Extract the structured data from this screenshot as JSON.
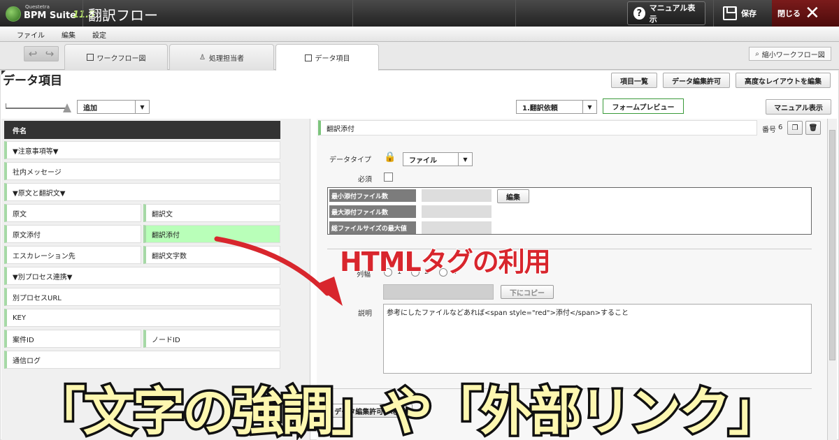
{
  "app": {
    "logo_small": "Questetra",
    "logo_name": "BPM Suite",
    "logo_version": "11.5",
    "title": "翻訳フロー",
    "manual_button": "マニュアル表示",
    "save_button": "保存",
    "close_button": "閉じる"
  },
  "menu": {
    "file": "ファイル",
    "edit": "編集",
    "settings": "設定"
  },
  "tabs": {
    "workflow": "ワークフロー図",
    "assignee": "処理担当者",
    "data_items": "データ項目",
    "mini_workflow": "縮小ワークフロー図"
  },
  "header": {
    "title": "データ項目",
    "item_list": "項目一覧",
    "edit_permission": "データ編集許可",
    "advanced_layout": "高度なレイアウトを編集"
  },
  "controls": {
    "add_select": "追加",
    "step_select": "1.翻訳依頼",
    "form_preview": "フォームプレビュー",
    "manual_button": "マニュアル表示"
  },
  "fields": {
    "f0": "件名",
    "f1": "▼注意事項等▼",
    "f2": "社内メッセージ",
    "f3": "▼原文と翻訳文▼",
    "f4": "原文",
    "f5": "翻訳文",
    "f6": "原文添付",
    "f7": "翻訳添付",
    "f8": "エスカレーション先",
    "f9": "翻訳文字数",
    "f10": "▼別プロセス連携▼",
    "f11": "別プロセスURL",
    "f12": "KEY",
    "f13": "案件ID",
    "f14": "ノードID",
    "f15": "通信ログ"
  },
  "detail": {
    "field_name": "翻訳添付",
    "number_label": "番号",
    "number_value": "6",
    "datatype_label": "データタイプ",
    "datatype_value": "ファイル",
    "required_label": "必須",
    "min_files": "最小添付ファイル数",
    "max_files": "最大添付ファイル数",
    "max_size": "総ファイルサイズの最大値",
    "edit_button": "編集",
    "cols_label": "列幅",
    "radio1": "1",
    "radio2": "2",
    "radio4": "4",
    "copy_button": "下にコピー",
    "description_label": "説明",
    "description_value": "参考にしたファイルなどあれば<span style=\"red\">添付</span>すること",
    "move_button": "データ編集許可 へ移動"
  },
  "overlay": {
    "html_tag": "HTMLタグの利用",
    "headline": "「文字の強調」や「外部リンク」"
  },
  "colors": {
    "accent_green": "#a6d9a6",
    "highlight": "#b9ffb9",
    "overlay_red": "#d8262d",
    "headline_fill": "#fdf7b0"
  }
}
